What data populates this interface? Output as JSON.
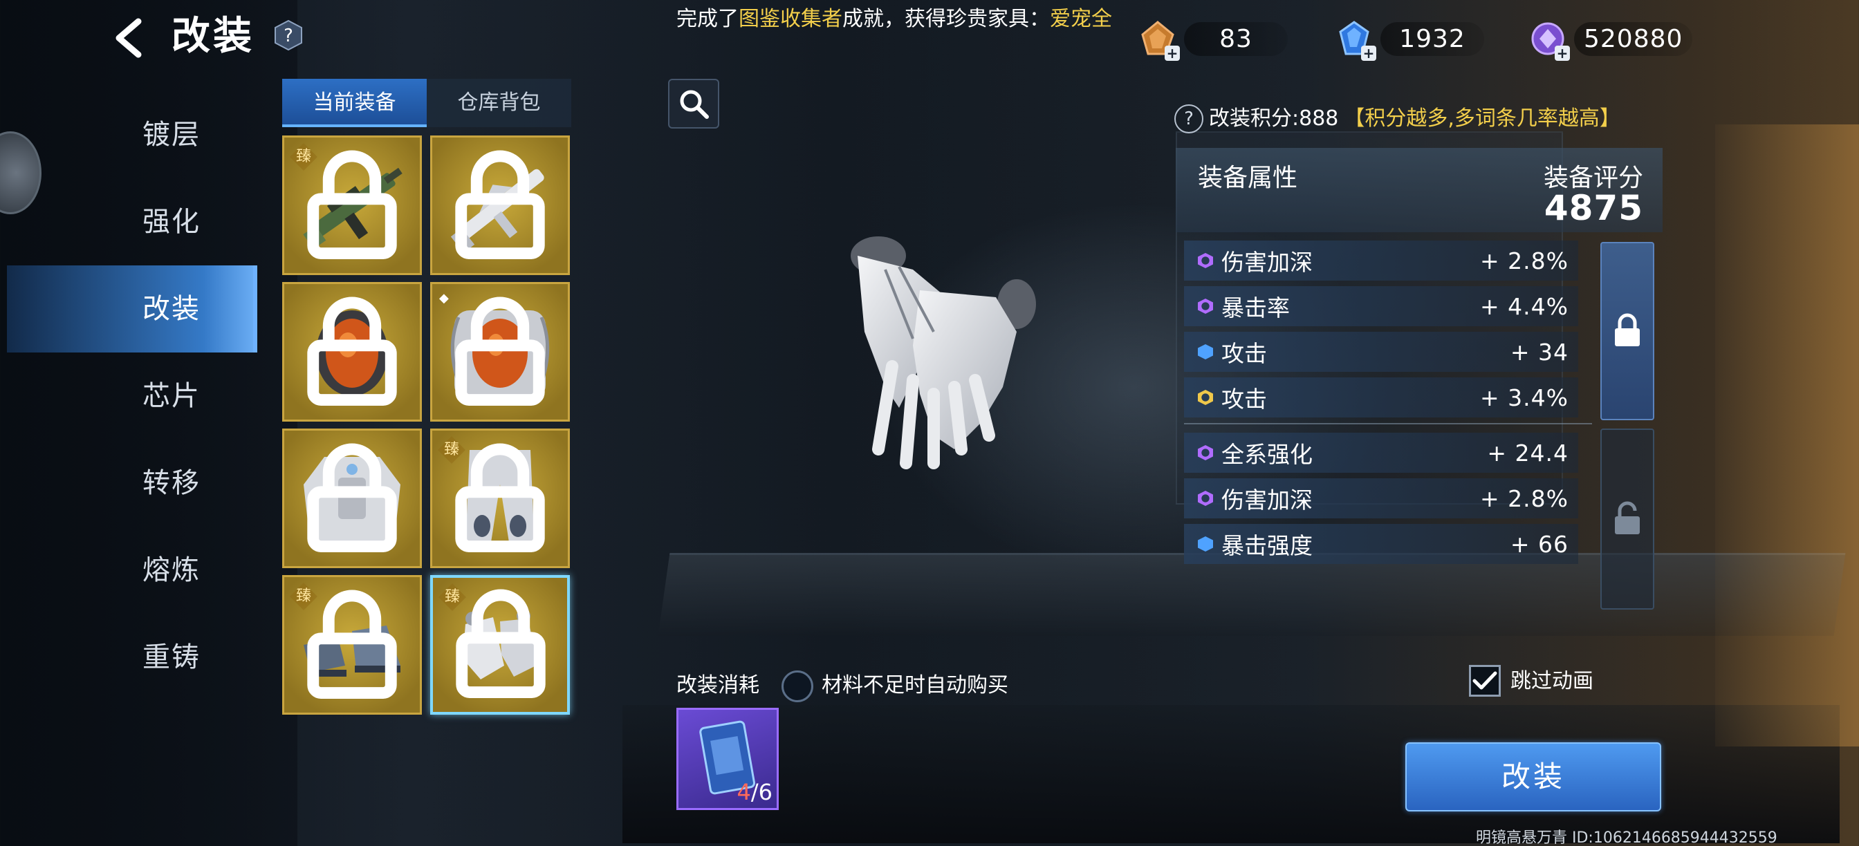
{
  "header": {
    "title": "改装",
    "announcement": {
      "prefix": "完成了",
      "achievement": "图鉴收集者",
      "middle": "成就，获得珍贵家具：",
      "reward": "爱宠全"
    },
    "currencies": [
      {
        "icon": "bronze-gem-icon",
        "value": "83"
      },
      {
        "icon": "blue-crystal-icon",
        "value": "1932"
      },
      {
        "icon": "purple-coin-icon",
        "value": "520880"
      }
    ]
  },
  "nav": {
    "items": [
      {
        "label": "镀层"
      },
      {
        "label": "强化"
      },
      {
        "label": "改装"
      },
      {
        "label": "芯片"
      },
      {
        "label": "转移"
      },
      {
        "label": "熔炼"
      },
      {
        "label": "重铸"
      }
    ],
    "active": "改装"
  },
  "equipment": {
    "tabs": [
      {
        "label": "当前装备"
      },
      {
        "label": "仓库背包"
      }
    ],
    "badge_zhen": "臻",
    "slots": [
      {
        "icon": "rifle-icon",
        "badge": "臻"
      },
      {
        "icon": "white-rifle-icon",
        "badge": ""
      },
      {
        "icon": "helmet-icon",
        "badge": ""
      },
      {
        "icon": "backpack-helmet-icon",
        "badge": "diamond"
      },
      {
        "icon": "armor-top-icon",
        "badge": ""
      },
      {
        "icon": "armor-pants-icon",
        "badge": "臻"
      },
      {
        "icon": "boots-icon",
        "badge": "臻"
      },
      {
        "icon": "gloves-icon",
        "badge": "臻",
        "selected": true
      }
    ]
  },
  "modify": {
    "score_label": "改装积分:888",
    "score_tip": "【积分越多,多词条几率越高】",
    "attr_title": "装备属性",
    "rating_label": "装备评分",
    "rating_value": "4875",
    "locked_attrs": [
      {
        "name": "伤害加深",
        "value": "+ 2.8%",
        "color": "#b06cff",
        "shape": "ring"
      },
      {
        "name": "暴击率",
        "value": "+ 4.4%",
        "color": "#b06cff",
        "shape": "ring"
      },
      {
        "name": "攻击",
        "value": "+ 34",
        "color": "#4fa2ff",
        "shape": "solid"
      },
      {
        "name": "攻击",
        "value": "+ 3.4%",
        "color": "#f0c84a",
        "shape": "ring"
      }
    ],
    "unlocked_attrs": [
      {
        "name": "全系强化",
        "value": "+ 24.4",
        "color": "#b06cff",
        "shape": "ring"
      },
      {
        "name": "伤害加深",
        "value": "+ 2.8%",
        "color": "#b06cff",
        "shape": "ring"
      },
      {
        "name": "暴击强度",
        "value": "+ 66",
        "color": "#4fa2ff",
        "shape": "solid"
      }
    ],
    "cost_label": "改装消耗",
    "auto_buy_label": "材料不足时自动购买",
    "material": {
      "have": "4",
      "need": "/6"
    },
    "skip_label": "跳过动画",
    "skip_checked": true,
    "primary_button": "改装"
  },
  "footer": {
    "id_text": "明镜高悬万青   ID:1062146685944432559"
  }
}
